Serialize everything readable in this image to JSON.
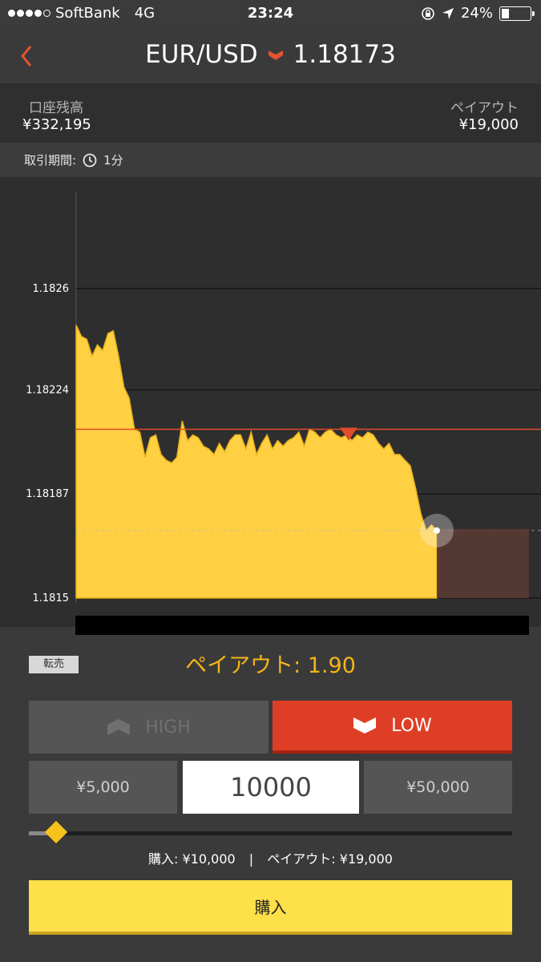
{
  "status_bar": {
    "carrier": "SoftBank",
    "network": "4G",
    "time": "23:24",
    "battery": "24%"
  },
  "header": {
    "pair": "EUR/USD",
    "price": "1.18173"
  },
  "account": {
    "balance_label": "口座残高",
    "balance_value": "¥332,195",
    "payout_label": "ペイアウト",
    "payout_value": "¥19,000"
  },
  "period": {
    "label": "取引期間:",
    "value": "1分"
  },
  "chart_data": {
    "type": "area",
    "ytick_labels": [
      "1.1826",
      "1.18224",
      "1.18187",
      "1.1815"
    ],
    "yticks": [
      1.1826,
      1.18224,
      1.18187,
      1.1815
    ],
    "ylim": [
      1.1815,
      1.1826
    ],
    "strike": 1.1821,
    "current": 1.18174,
    "series": [
      {
        "values": [
          1.18247,
          1.18243,
          1.18242,
          1.18236,
          1.1824,
          1.18238,
          1.18244,
          1.18245,
          1.18236,
          1.18225,
          1.18221,
          1.1821,
          1.18209,
          1.182,
          1.18207,
          1.18208,
          1.18201,
          1.18199,
          1.18198,
          1.182,
          1.18213,
          1.18206,
          1.18208,
          1.18207,
          1.18204,
          1.18203,
          1.18201,
          1.18205,
          1.18202,
          1.18206,
          1.18208,
          1.18208,
          1.18203,
          1.18209,
          1.18201,
          1.18205,
          1.18208,
          1.18203,
          1.18206,
          1.18204,
          1.18206,
          1.18207,
          1.18209,
          1.18204,
          1.1821,
          1.18209,
          1.18207,
          1.18209,
          1.1821,
          1.18208,
          1.18207,
          1.18208,
          1.18206,
          1.18208,
          1.18207,
          1.18209,
          1.18208,
          1.18205,
          1.18203,
          1.18205,
          1.18201,
          1.18201,
          1.18199,
          1.18197,
          1.18189,
          1.1818,
          1.18174,
          1.18176,
          1.18174
        ]
      }
    ],
    "colors": {
      "area": "#fed042",
      "strike_line": "#e24c2b",
      "marker": "#e24c2b"
    }
  },
  "trade": {
    "resale_label": "転売",
    "payout_rate": "ペイアウト: 1.90",
    "high_label": "HIGH",
    "low_label": "LOW",
    "amount_5k": "¥5,000",
    "amount_value": "10000",
    "amount_50k": "¥50,000",
    "slider_fraction": 0.06,
    "summary_purchase": "購入: ¥10,000",
    "summary_sep": "|",
    "summary_payout": "ペイアウト: ¥19,000",
    "buy_label": "購入"
  }
}
